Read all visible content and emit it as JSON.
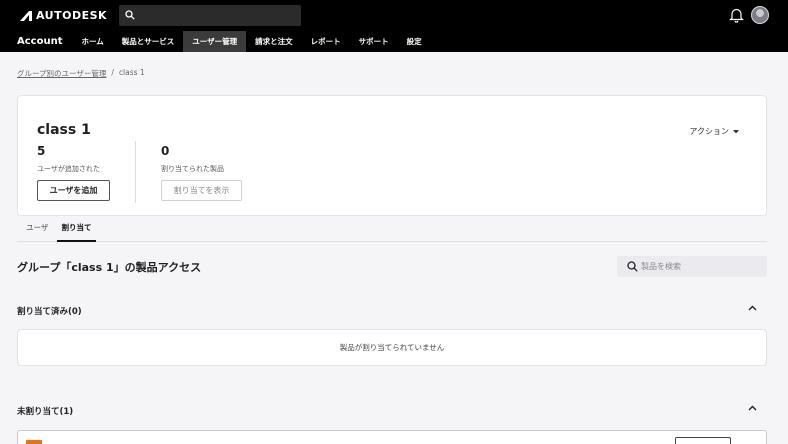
{
  "header": {
    "logo_text": "AUTODESK",
    "search_placeholder": ""
  },
  "nav": {
    "account_label": "Account",
    "items": [
      {
        "label": "ホーム",
        "active": false
      },
      {
        "label": "製品とサービス",
        "active": false
      },
      {
        "label": "ユーザー管理",
        "active": true
      },
      {
        "label": "請求と注文",
        "active": false
      },
      {
        "label": "レポート",
        "active": false
      },
      {
        "label": "サポート",
        "active": false
      },
      {
        "label": "設定",
        "active": false
      }
    ]
  },
  "breadcrumb": {
    "parent": "グループ別のユーザー管理",
    "separator": "/",
    "current": "class 1"
  },
  "card": {
    "title": "class 1",
    "action_label": "アクション",
    "users_count": "5",
    "users_label": "ユーザが追加された",
    "products_count": "0",
    "products_label": "割り当てられた製品",
    "add_user_label": "ユーザを追加",
    "view_assign_label": "割り当てを表示"
  },
  "tabs": {
    "users": "ユーザ",
    "assignments": "割り当て"
  },
  "section": {
    "title": "グループ「class 1」の製品アクセス",
    "search_placeholder": "製品を検索"
  },
  "assigned": {
    "header": "割り当て済み(0)",
    "empty_text": "製品が割り当てられていません"
  },
  "unassigned": {
    "header": "未割り当て(1)"
  },
  "colors": {
    "topbar": "#000000",
    "nav_active": "#3b3b3b",
    "page_bg": "#f5f5f7",
    "product_icon": "#e8701a"
  }
}
